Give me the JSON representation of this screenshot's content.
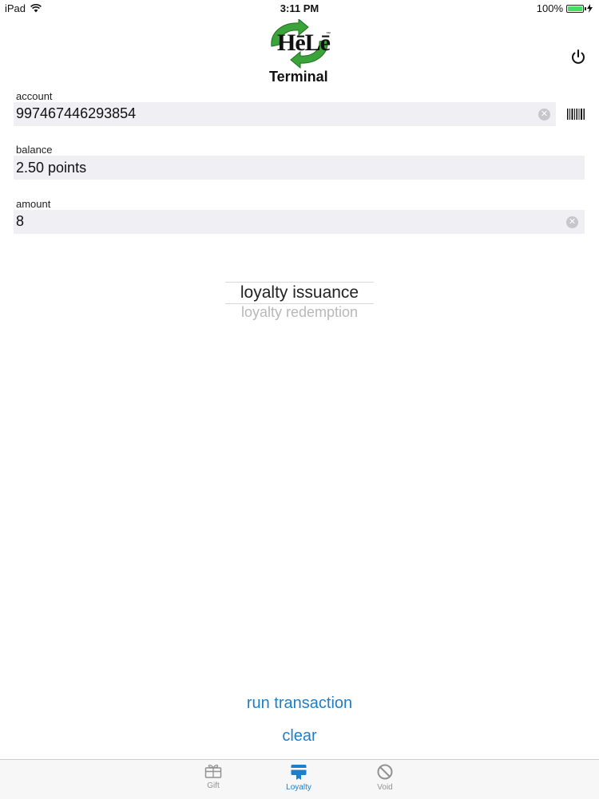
{
  "status_bar": {
    "device": "iPad",
    "time": "3:11 PM",
    "battery": "100%"
  },
  "header": {
    "logo_word": "HēLē",
    "logo_tm": "™",
    "logo_sub": "Terminal"
  },
  "fields": {
    "account": {
      "label": "account",
      "value": "997467446293854"
    },
    "balance": {
      "label": "balance",
      "value": "2.50 points"
    },
    "amount": {
      "label": "amount",
      "value": "8"
    }
  },
  "picker": {
    "selected": "loyalty issuance",
    "options": [
      "loyalty issuance",
      "loyalty redemption"
    ],
    "other": "loyalty redemption"
  },
  "actions": {
    "run": "run transaction",
    "clear": "clear"
  },
  "tabs": [
    {
      "label": "Gift",
      "icon": "gift-card-icon",
      "active": false
    },
    {
      "label": "Loyalty",
      "icon": "loyalty-card-icon",
      "active": true
    },
    {
      "label": "Void",
      "icon": "void-icon",
      "active": false
    }
  ],
  "colors": {
    "accent": "#1f7ec8",
    "tab_inactive": "#929292",
    "field_bg": "#efeff4",
    "battery": "#4cd964",
    "logo_green": "#3aa33a"
  }
}
